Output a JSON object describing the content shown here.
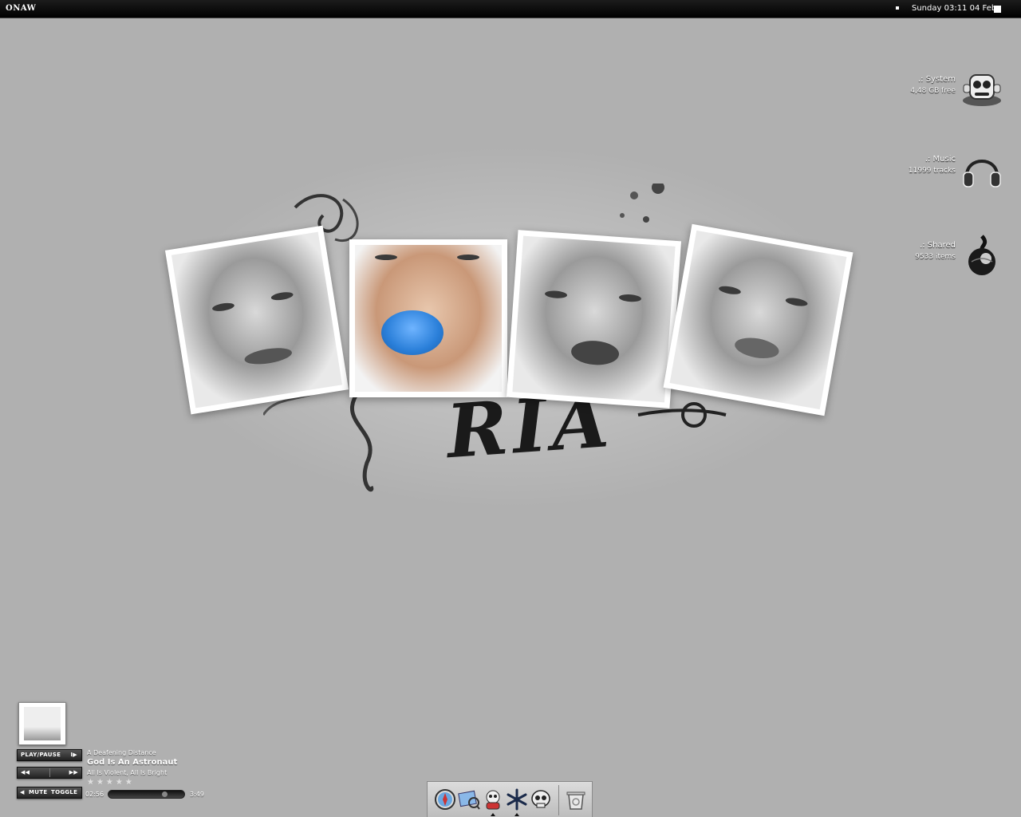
{
  "menubar": {
    "logo": "ONAW",
    "clock": "Sunday 03:11 04 Feb"
  },
  "wallpaper": {
    "signature": "RIA"
  },
  "drives": [
    {
      "name": ".: System",
      "sub": "4,48 GB free",
      "icon": "robot-drive-icon"
    },
    {
      "name": ".: Music",
      "sub": "11999  tracks",
      "icon": "headphones-icon"
    },
    {
      "name": ".: Shared",
      "sub": "9533  items",
      "icon": "flame-globe-icon"
    }
  ],
  "player": {
    "play_pause_label": "PLAY/PAUSE",
    "mute_label": "MUTE",
    "toggle_label": "TOGGLE",
    "artist": "A Deafening Distance",
    "title": "God Is An Astronaut",
    "album": "All Is Violent, All Is Bright",
    "rating_stars": "★★★★★",
    "elapsed": "02:56",
    "total": "3:49",
    "progress": 0.77
  },
  "dock": {
    "items": [
      {
        "name": "safari-compass-icon"
      },
      {
        "name": "mail-preview-icon"
      },
      {
        "name": "adium-duck-icon",
        "running": true
      },
      {
        "name": "snowflake-app-icon",
        "running": true
      },
      {
        "name": "skull-app-icon"
      },
      {
        "name": "trash-icon"
      }
    ]
  },
  "colors": {
    "background": "#b0b0b0",
    "menubar": "#000000",
    "lips_accent": "#3a8ee6"
  }
}
